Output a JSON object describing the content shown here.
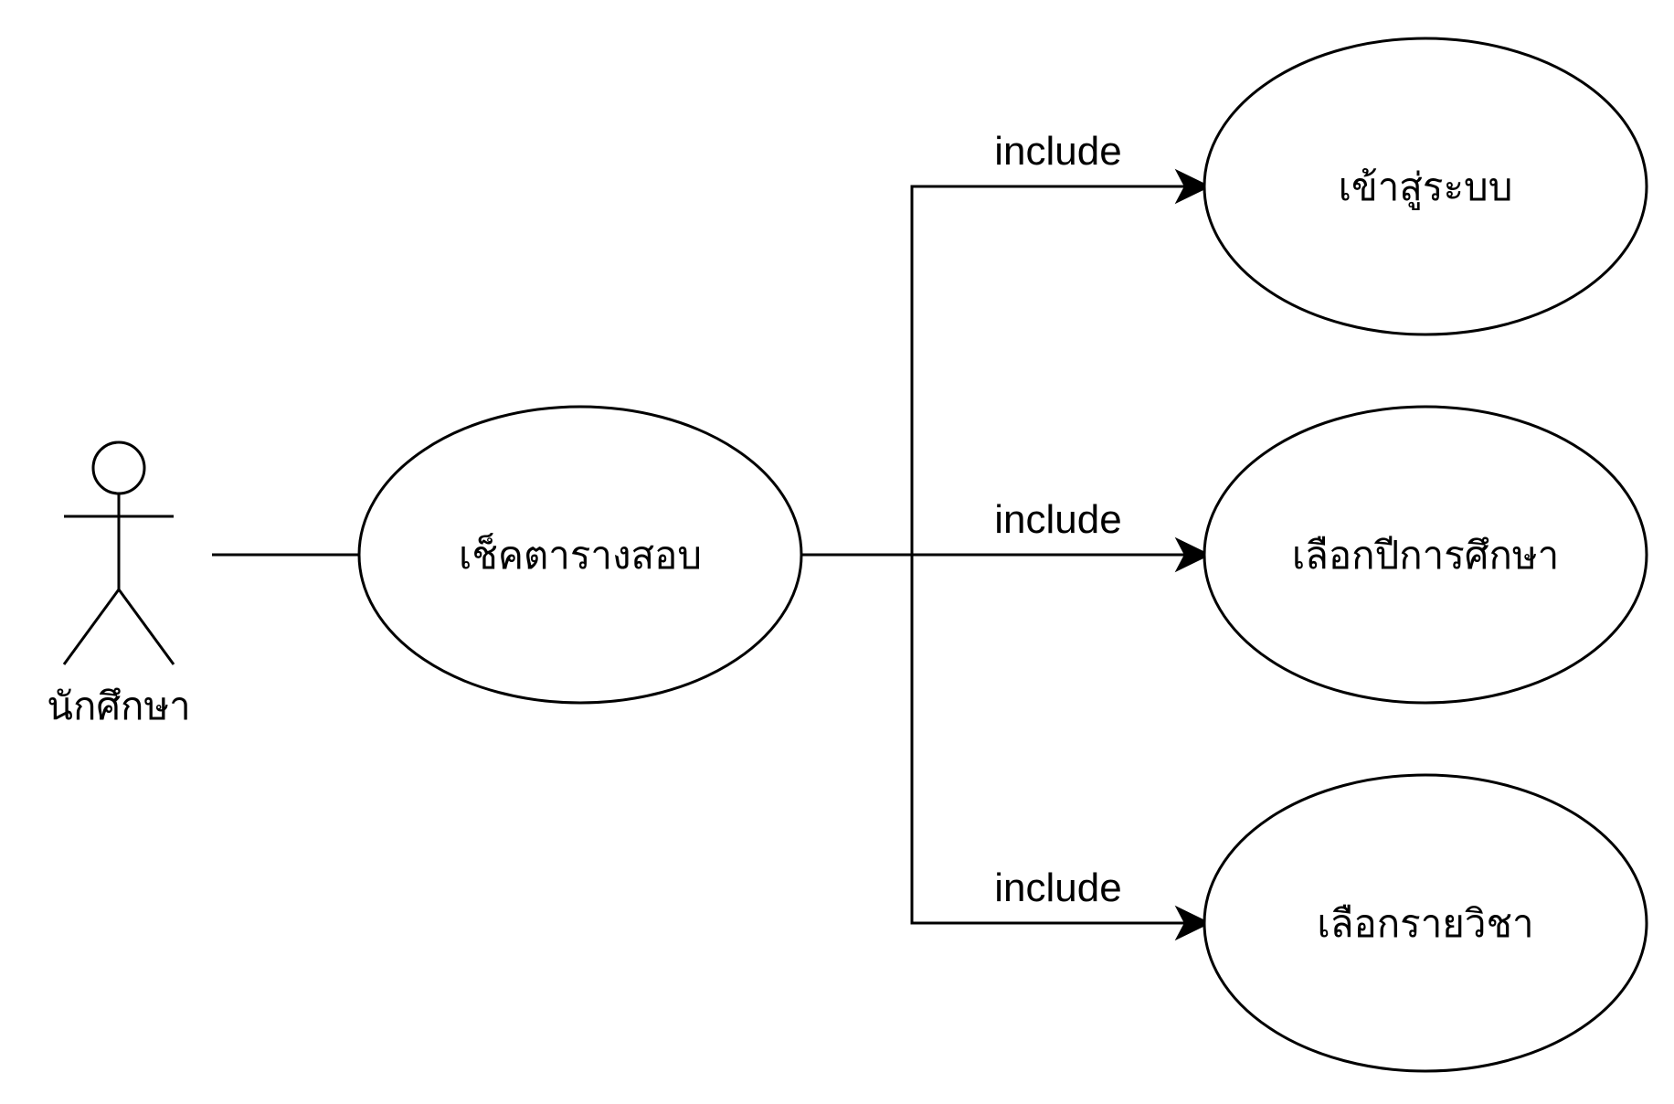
{
  "actor": {
    "label": "นักศึกษา",
    "icon": "stick-figure-icon"
  },
  "use_cases": {
    "main": "เช็คตารางสอบ",
    "login": "เข้าสู่ระบบ",
    "select_year": "เลือกปีการศึกษา",
    "select_subject": "เลือกรายวิชา"
  },
  "relations": {
    "login_label": "include",
    "year_label": "include",
    "subject_label": "include"
  },
  "colors": {
    "stroke": "#000000",
    "fill": "#ffffff",
    "background": "#ffffff"
  }
}
